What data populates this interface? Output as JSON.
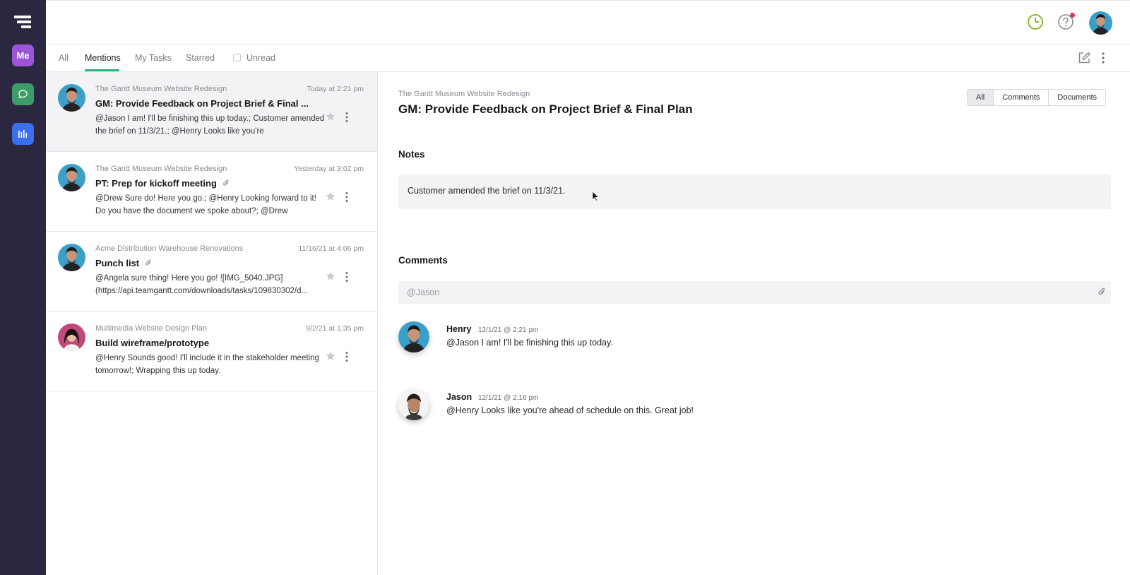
{
  "sidebar": {
    "me_label": "Me",
    "icons": [
      "menu-logo-icon",
      "chat-icon",
      "gantt-chart-icon"
    ]
  },
  "header": {
    "icons": [
      "clock-icon",
      "help-icon",
      "user-avatar"
    ],
    "colors": {
      "clock": "#8ab833",
      "notification": "#e8345a"
    }
  },
  "tabs": [
    {
      "label": "All",
      "active": false
    },
    {
      "label": "Mentions",
      "active": true
    },
    {
      "label": "My Tasks",
      "active": false
    },
    {
      "label": "Starred",
      "active": false
    },
    {
      "label": "Unread",
      "active": false,
      "checkbox": true
    }
  ],
  "mentions": [
    {
      "project": "The Gantt Museum Website Redesign",
      "time": "Today at 2:21 pm",
      "title": "GM: Provide Feedback on Project Brief & Final ...",
      "attachment": false,
      "preview": "@Jason I am! I'll be finishing this up today.; Customer amended the brief on 11/3/21.; @Henry Looks like you're",
      "selected": true
    },
    {
      "project": "The Gantt Museum Website Redesign",
      "time": "Yesterday at 3:02 pm",
      "title": "PT: Prep for kickoff meeting",
      "attachment": true,
      "preview": "@Drew Sure do! Here you go.; @Henry Looking forward to it! Do you have the document we spoke about?; @Drew",
      "selected": false
    },
    {
      "project": "Acme Distribution Warehouse Renovations",
      "time": "11/16/21 at 4:06 pm",
      "title": "Punch list",
      "attachment": true,
      "preview": "@Angela sure thing! Here you go! ![IMG_5040.JPG] (https://api.teamgantt.com/downloads/tasks/109830302/d...",
      "selected": false
    },
    {
      "project": "Multimedia Website Design Plan",
      "time": "9/2/21 at 1:35 pm",
      "title": "Build wireframe/prototype",
      "attachment": false,
      "preview": "@Henry Sounds good! I'll include it in the stakeholder meeting tomorrow!; Wrapping this up today.",
      "selected": false
    }
  ],
  "detail": {
    "project": "The Gantt Museum Website Redesign",
    "title": "GM: Provide Feedback on Project Brief & Final Plan",
    "filters": [
      "All",
      "Comments",
      "Documents"
    ],
    "active_filter": "All",
    "notes_heading": "Notes",
    "notes_text": "Customer amended the brief on 11/3/21.",
    "comments_heading": "Comments",
    "comment_placeholder": "@Jason",
    "comments": [
      {
        "author": "Henry",
        "time": "12/1/21 @ 2:21 pm",
        "text": "@Jason I am! I'll be finishing this up today."
      },
      {
        "author": "Jason",
        "time": "12/1/21 @ 2:16 pm",
        "text": "@Henry Looks like you're ahead of schedule on this. Great job!"
      }
    ]
  },
  "colors": {
    "sidebar_bg": "#2b2740",
    "me_button": "#9b55d6",
    "chat_button": "#3d9c6a",
    "gantt_button": "#3a6ff0",
    "tab_underline": "#2db37a"
  }
}
